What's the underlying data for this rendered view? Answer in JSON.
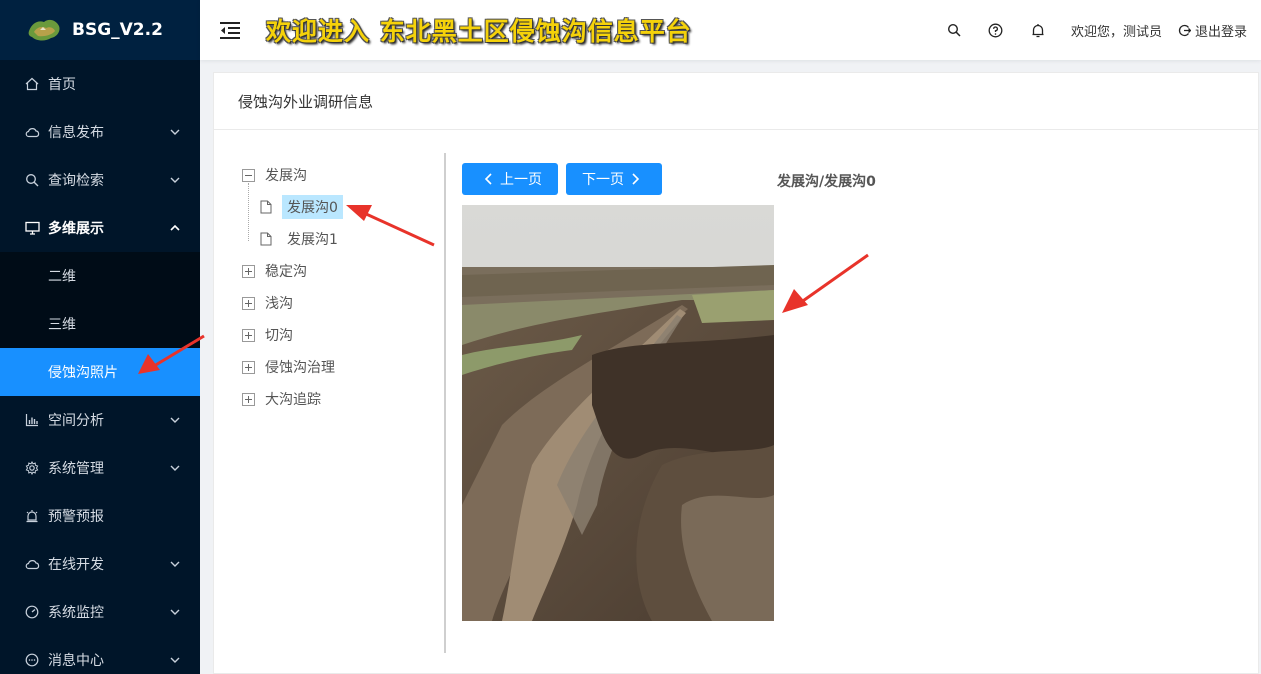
{
  "app": {
    "name": "BSG_V2.2",
    "header_title": "欢迎进入 东北黑土区侵蚀沟信息平台"
  },
  "header": {
    "greeting": "欢迎您，测试员",
    "logout_label": "退出登录"
  },
  "sidebar": {
    "items": [
      {
        "label": "首页",
        "icon": "home-icon"
      },
      {
        "label": "信息发布",
        "icon": "cloud-icon"
      },
      {
        "label": "查询检索",
        "icon": "search-icon"
      },
      {
        "label": "多维展示",
        "icon": "monitor-icon"
      },
      {
        "label": "空间分析",
        "icon": "bar-chart-icon"
      },
      {
        "label": "系统管理",
        "icon": "gear-icon"
      },
      {
        "label": "预警预报",
        "icon": "alarm-icon"
      },
      {
        "label": "在线开发",
        "icon": "cloud-icon"
      },
      {
        "label": "系统监控",
        "icon": "dashboard-icon"
      },
      {
        "label": "消息中心",
        "icon": "message-icon"
      }
    ],
    "submenu": [
      {
        "label": "二维"
      },
      {
        "label": "三维"
      },
      {
        "label": "侵蚀沟照片"
      }
    ]
  },
  "card": {
    "title": "侵蚀沟外业调研信息"
  },
  "tree": {
    "root": "发展沟",
    "children": [
      "发展沟0",
      "发展沟1"
    ],
    "others": [
      "稳定沟",
      "浅沟",
      "切沟",
      "侵蚀沟治理",
      "大沟追踪"
    ]
  },
  "viewer": {
    "prev_label": "上一页",
    "next_label": "下一页",
    "path": "发展沟/发展沟0"
  },
  "colors": {
    "sidebar_bg": "#001529",
    "active": "#1890ff",
    "selected_node": "#bae7ff",
    "title_yellow": "#f5d20a",
    "annotation_red": "#e8332a"
  }
}
